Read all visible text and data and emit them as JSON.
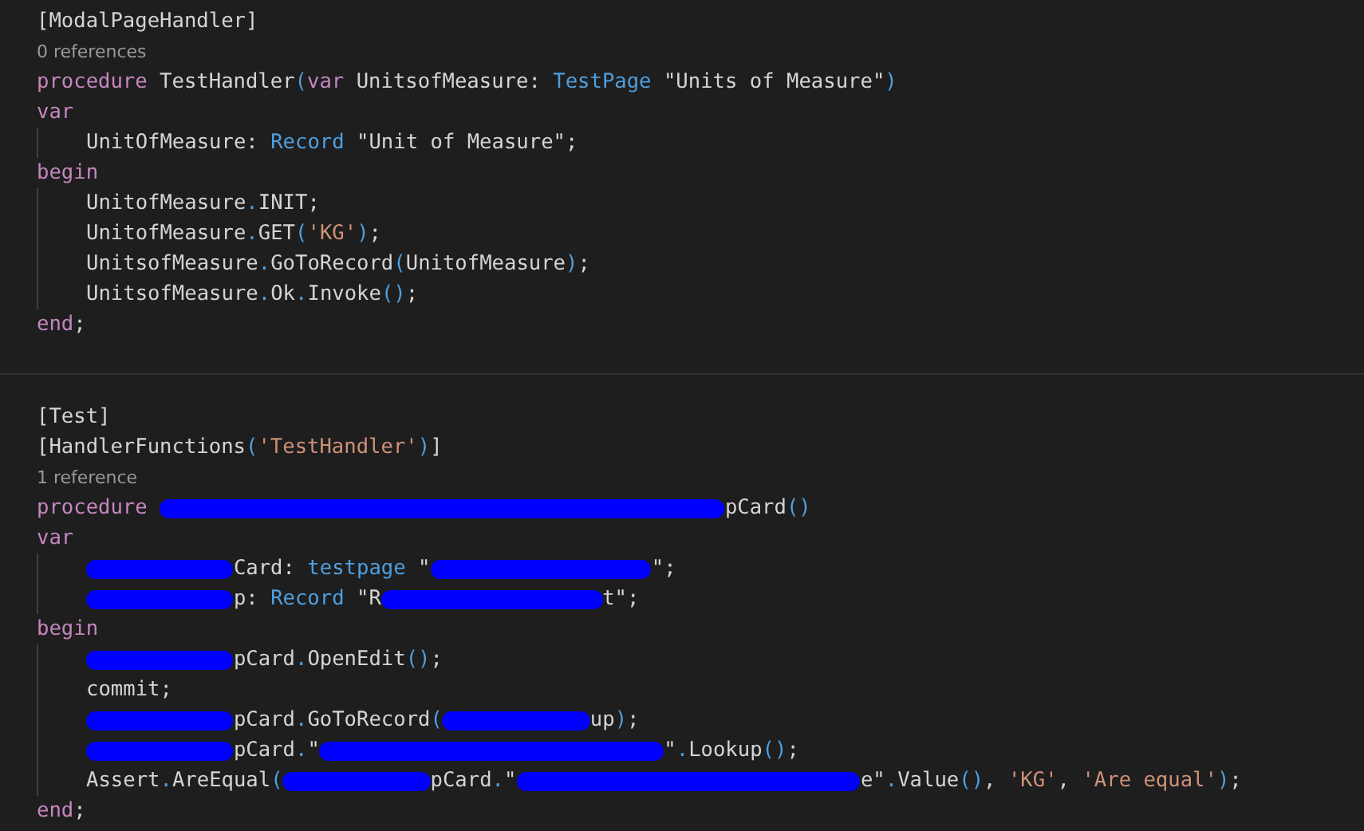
{
  "blocks": [
    {
      "lines": [
        {
          "kind": "code",
          "indented": false,
          "tokens": [
            {
              "kind": "plain",
              "text": "[ModalPageHandler]"
            }
          ]
        },
        {
          "kind": "codelens",
          "text": "0 references"
        },
        {
          "kind": "code",
          "indented": false,
          "tokens": [
            {
              "kind": "keyword",
              "text": "procedure"
            },
            {
              "kind": "plain",
              "text": " TestHandler"
            },
            {
              "kind": "punct",
              "text": "("
            },
            {
              "kind": "keyword",
              "text": "var"
            },
            {
              "kind": "plain",
              "text": " UnitsofMeasure: "
            },
            {
              "kind": "type",
              "text": "TestPage"
            },
            {
              "kind": "plain",
              "text": " \"Units of Measure\""
            },
            {
              "kind": "punct",
              "text": ")"
            }
          ]
        },
        {
          "kind": "code",
          "indented": false,
          "tokens": [
            {
              "kind": "keyword",
              "text": "var"
            }
          ]
        },
        {
          "kind": "code",
          "indented": true,
          "tokens": [
            {
              "kind": "plain",
              "text": "UnitOfMeasure: "
            },
            {
              "kind": "type",
              "text": "Record"
            },
            {
              "kind": "plain",
              "text": " \"Unit of Measure\";"
            }
          ]
        },
        {
          "kind": "code",
          "indented": false,
          "tokens": [
            {
              "kind": "keyword",
              "text": "begin"
            }
          ]
        },
        {
          "kind": "code",
          "indented": true,
          "tokens": [
            {
              "kind": "plain",
              "text": "UnitofMeasure"
            },
            {
              "kind": "punct",
              "text": "."
            },
            {
              "kind": "plain",
              "text": "INIT;"
            }
          ]
        },
        {
          "kind": "code",
          "indented": true,
          "tokens": [
            {
              "kind": "plain",
              "text": "UnitofMeasure"
            },
            {
              "kind": "punct",
              "text": "."
            },
            {
              "kind": "plain",
              "text": "GET"
            },
            {
              "kind": "punct",
              "text": "("
            },
            {
              "kind": "string",
              "text": "'KG'"
            },
            {
              "kind": "punct",
              "text": ")"
            },
            {
              "kind": "plain",
              "text": ";"
            }
          ]
        },
        {
          "kind": "code",
          "indented": true,
          "tokens": [
            {
              "kind": "plain",
              "text": "UnitsofMeasure"
            },
            {
              "kind": "punct",
              "text": "."
            },
            {
              "kind": "plain",
              "text": "GoToRecord"
            },
            {
              "kind": "punct",
              "text": "("
            },
            {
              "kind": "plain",
              "text": "UnitofMeasure"
            },
            {
              "kind": "punct",
              "text": ")"
            },
            {
              "kind": "plain",
              "text": ";"
            }
          ]
        },
        {
          "kind": "code",
          "indented": true,
          "tokens": [
            {
              "kind": "plain",
              "text": "UnitsofMeasure"
            },
            {
              "kind": "punct",
              "text": "."
            },
            {
              "kind": "plain",
              "text": "Ok"
            },
            {
              "kind": "punct",
              "text": "."
            },
            {
              "kind": "plain",
              "text": "Invoke"
            },
            {
              "kind": "punct",
              "text": "()"
            },
            {
              "kind": "plain",
              "text": ";"
            }
          ]
        },
        {
          "kind": "code",
          "indented": false,
          "tokens": [
            {
              "kind": "keyword",
              "text": "end"
            },
            {
              "kind": "plain",
              "text": ";"
            }
          ]
        }
      ]
    },
    {
      "lines": [
        {
          "kind": "code",
          "indented": false,
          "tokens": [
            {
              "kind": "plain",
              "text": "[Test]"
            }
          ]
        },
        {
          "kind": "code",
          "indented": false,
          "tokens": [
            {
              "kind": "plain",
              "text": "[HandlerFunctions"
            },
            {
              "kind": "punct",
              "text": "("
            },
            {
              "kind": "string",
              "text": "'TestHandler'"
            },
            {
              "kind": "punct",
              "text": ")"
            },
            {
              "kind": "plain",
              "text": "]"
            }
          ]
        },
        {
          "kind": "codelens",
          "text": "1 reference"
        },
        {
          "kind": "code",
          "indented": false,
          "tokens": [
            {
              "kind": "keyword",
              "text": "procedure "
            },
            {
              "kind": "redaction-wide"
            },
            {
              "kind": "plain",
              "text": "pCard"
            },
            {
              "kind": "punct",
              "text": "()"
            }
          ]
        },
        {
          "kind": "code",
          "indented": false,
          "tokens": [
            {
              "kind": "keyword",
              "text": "var"
            }
          ]
        },
        {
          "kind": "code",
          "indented": true,
          "tokens": [
            {
              "kind": "redaction-short"
            },
            {
              "kind": "plain",
              "text": "Card: "
            },
            {
              "kind": "type",
              "text": "testpage"
            },
            {
              "kind": "plain",
              "text": " \""
            },
            {
              "kind": "redaction-medium"
            },
            {
              "kind": "plain",
              "text": "\";"
            }
          ]
        },
        {
          "kind": "code",
          "indented": true,
          "tokens": [
            {
              "kind": "redaction-short"
            },
            {
              "kind": "plain",
              "text": "p: "
            },
            {
              "kind": "type",
              "text": "Record"
            },
            {
              "kind": "plain",
              "text": " \"R"
            },
            {
              "kind": "redaction-medium"
            },
            {
              "kind": "plain",
              "text": "t\";"
            }
          ]
        },
        {
          "kind": "code",
          "indented": false,
          "tokens": [
            {
              "kind": "keyword",
              "text": "begin"
            }
          ]
        },
        {
          "kind": "code",
          "indented": true,
          "tokens": [
            {
              "kind": "redaction-short"
            },
            {
              "kind": "plain",
              "text": "pCard"
            },
            {
              "kind": "punct",
              "text": "."
            },
            {
              "kind": "plain",
              "text": "OpenEdit"
            },
            {
              "kind": "punct",
              "text": "()"
            },
            {
              "kind": "plain",
              "text": ";"
            }
          ]
        },
        {
          "kind": "code",
          "indented": true,
          "tokens": [
            {
              "kind": "plain",
              "text": "commit;"
            }
          ]
        },
        {
          "kind": "code",
          "indented": true,
          "tokens": [
            {
              "kind": "redaction-short"
            },
            {
              "kind": "plain",
              "text": "pCard"
            },
            {
              "kind": "punct",
              "text": "."
            },
            {
              "kind": "plain",
              "text": "GoToRecord"
            },
            {
              "kind": "punct",
              "text": "("
            },
            {
              "kind": "redaction-short"
            },
            {
              "kind": "plain",
              "text": "up"
            },
            {
              "kind": "punct",
              "text": ")"
            },
            {
              "kind": "plain",
              "text": ";"
            }
          ]
        },
        {
          "kind": "code",
          "indented": true,
          "tokens": [
            {
              "kind": "redaction-short"
            },
            {
              "kind": "plain",
              "text": "pCard"
            },
            {
              "kind": "punct",
              "text": "."
            },
            {
              "kind": "plain",
              "text": "\""
            },
            {
              "kind": "redaction-long"
            },
            {
              "kind": "plain",
              "text": "\""
            },
            {
              "kind": "punct",
              "text": "."
            },
            {
              "kind": "plain",
              "text": "Lookup"
            },
            {
              "kind": "punct",
              "text": "()"
            },
            {
              "kind": "plain",
              "text": ";"
            }
          ]
        },
        {
          "kind": "code",
          "indented": true,
          "tokens": [
            {
              "kind": "plain",
              "text": "Assert"
            },
            {
              "kind": "punct",
              "text": "."
            },
            {
              "kind": "plain",
              "text": "AreEqual"
            },
            {
              "kind": "punct",
              "text": "("
            },
            {
              "kind": "redaction-short"
            },
            {
              "kind": "plain",
              "text": "pCard"
            },
            {
              "kind": "punct",
              "text": "."
            },
            {
              "kind": "plain",
              "text": "\""
            },
            {
              "kind": "redaction-long"
            },
            {
              "kind": "plain",
              "text": "e\""
            },
            {
              "kind": "punct",
              "text": "."
            },
            {
              "kind": "plain",
              "text": "Value"
            },
            {
              "kind": "punct",
              "text": "()"
            },
            {
              "kind": "plain",
              "text": ", "
            },
            {
              "kind": "string",
              "text": "'KG'"
            },
            {
              "kind": "plain",
              "text": ", "
            },
            {
              "kind": "string",
              "text": "'Are equal'"
            },
            {
              "kind": "punct",
              "text": ")"
            },
            {
              "kind": "plain",
              "text": ";"
            }
          ]
        },
        {
          "kind": "code",
          "indented": false,
          "tokens": [
            {
              "kind": "keyword",
              "text": "end"
            },
            {
              "kind": "plain",
              "text": ";"
            }
          ]
        }
      ]
    }
  ]
}
